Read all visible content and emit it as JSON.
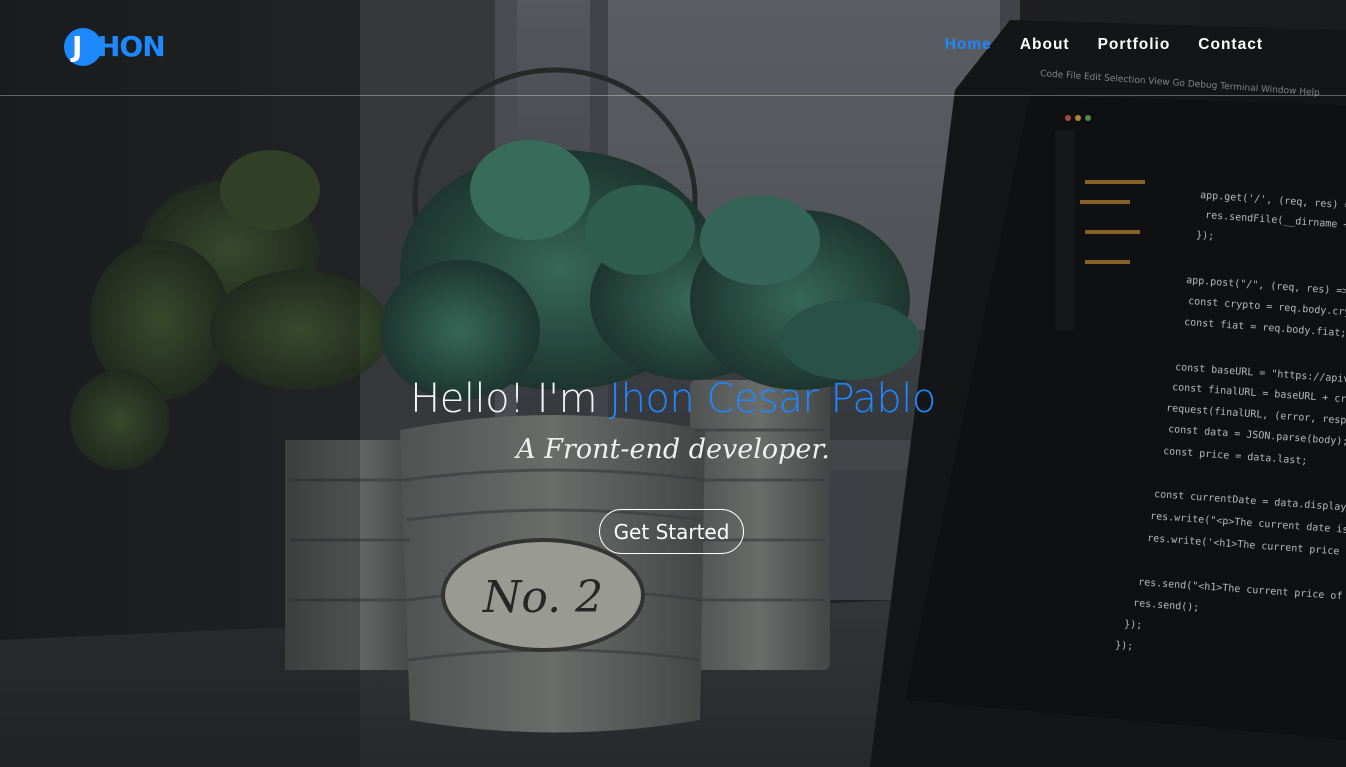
{
  "brand": {
    "logo_text": "JHON",
    "logo_initial": "J",
    "logo_rest": "HON",
    "accent_color": "#1e88ff"
  },
  "nav": {
    "items": [
      {
        "label": "Home",
        "active": true
      },
      {
        "label": "About",
        "active": false
      },
      {
        "label": "Portfolio",
        "active": false
      },
      {
        "label": "Contact",
        "active": false
      }
    ]
  },
  "hero": {
    "greeting": "Hello! I'm",
    "name": "Jhon Cesar Pablo",
    "tagline": "A Front-end developer.",
    "cta_label": "Get Started",
    "background_image": "potted succulent plants with 'No. 2' tin planter beside laptop showing code editor"
  }
}
